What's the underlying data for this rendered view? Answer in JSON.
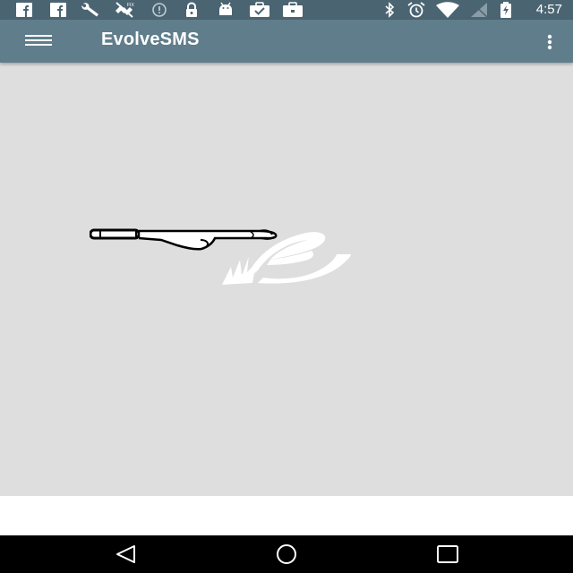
{
  "status_bar": {
    "time": "4:57",
    "left_icons": [
      "facebook-icon",
      "facebook-icon",
      "wrench-icon",
      "satellite-off-icon",
      "alert-circle-icon",
      "lock-icon",
      "android-icon",
      "work-briefcase-check-icon",
      "work-briefcase-icon"
    ],
    "right_icons": [
      "bluetooth-icon",
      "alarm-icon",
      "wifi-icon",
      "signal-off-icon",
      "battery-charging-icon"
    ]
  },
  "toolbar": {
    "title": "EvolveSMS",
    "menu_icon": "hamburger-menu-icon",
    "overflow_icon": "more-vertical-icon",
    "color": "#607d8b"
  },
  "content": {
    "background": "#dedede",
    "logo": "evolvesms-logo",
    "pointer": "pointing-hand-icon"
  },
  "nav_bar": {
    "buttons": [
      "back-icon",
      "home-icon",
      "recents-icon"
    ]
  }
}
